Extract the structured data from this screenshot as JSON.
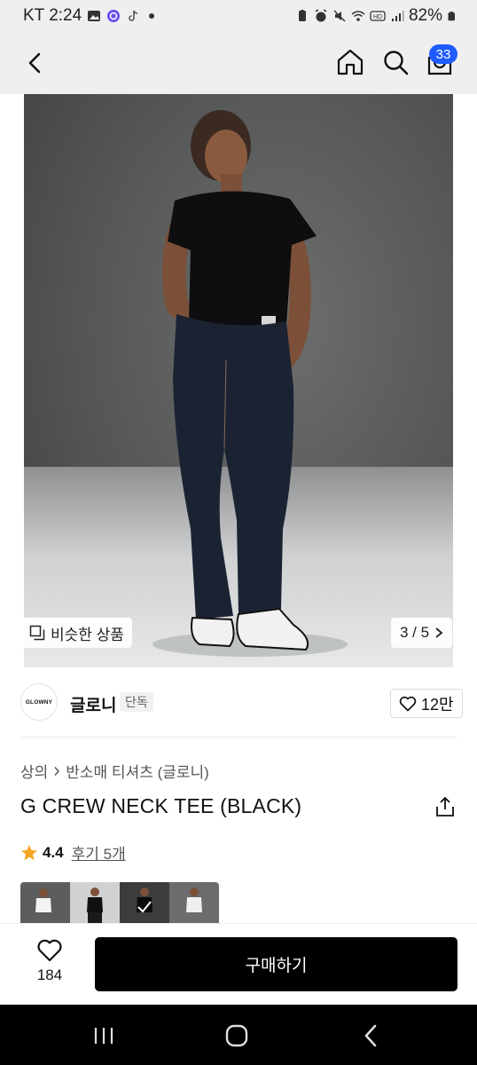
{
  "status_bar": {
    "carrier_time": "KT 2:24",
    "battery": "82%"
  },
  "header": {
    "cart_count": "33"
  },
  "gallery": {
    "similar_label": "비슷한 상품",
    "pager": "3 / 5"
  },
  "brand": {
    "logo_text": "GLOWNY",
    "name": "글로니",
    "tag": "단독",
    "likes": "12만"
  },
  "product": {
    "breadcrumb": [
      "상의",
      "반소매 티셔츠 (글로니)"
    ],
    "title": "G CREW NECK TEE (BLACK)",
    "rating": "4.4",
    "reviews": "후기 5개"
  },
  "colors": {
    "accent": "#1f5cff",
    "star": "#f5a623",
    "buy_button": "#000000"
  },
  "buy_bar": {
    "wish_count": "184",
    "buy_label": "구매하기"
  }
}
